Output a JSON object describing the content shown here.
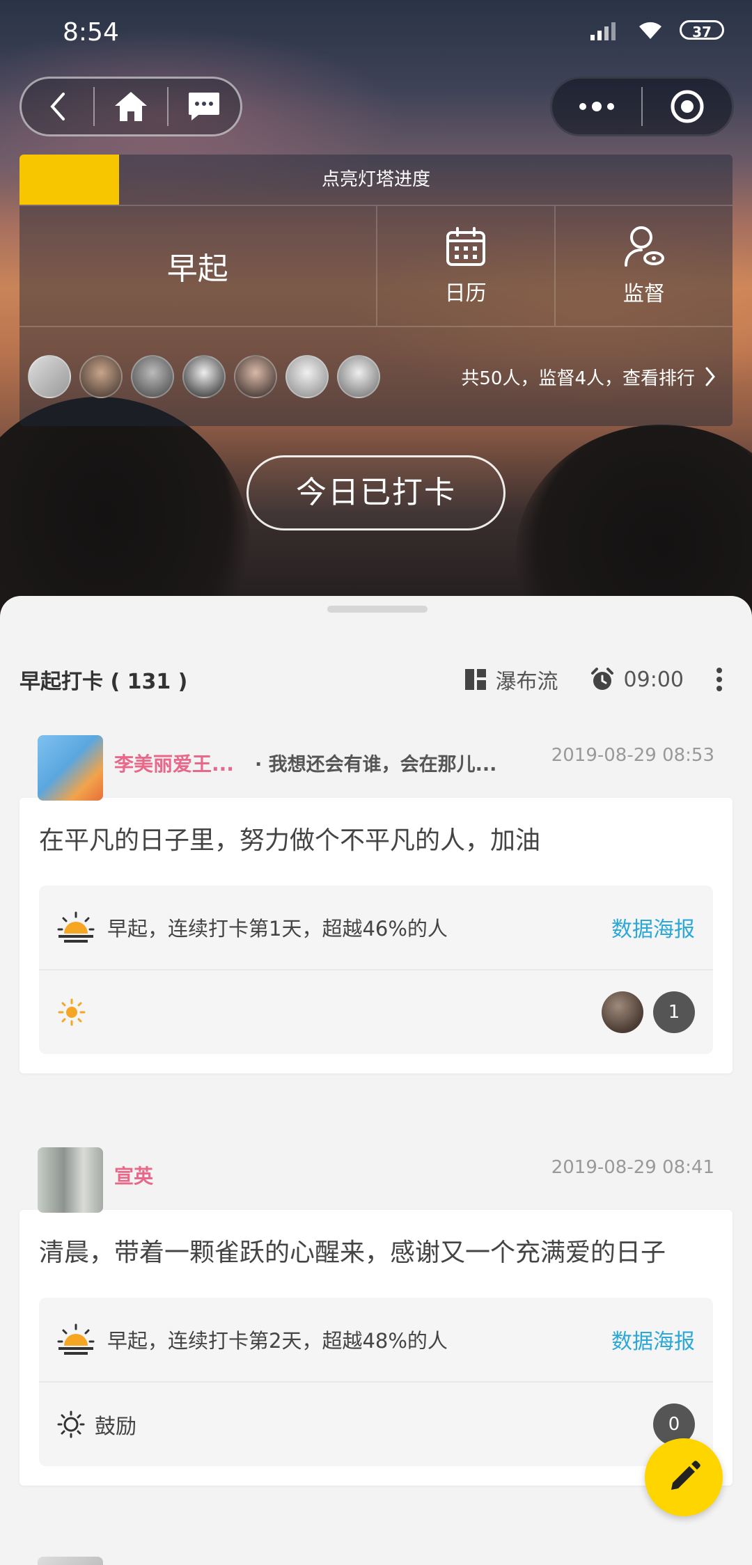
{
  "status": {
    "time": "8:54",
    "battery": "37"
  },
  "hero": {
    "progress_label": "点亮灯塔进度",
    "progress_fraction": 0.14,
    "main_action": "早起",
    "calendar_label": "日历",
    "supervise_label": "监督",
    "members_summary": "共50人，监督4人，查看排行",
    "checkin_button": "今日已打卡"
  },
  "feed": {
    "title": "早起打卡 ( 131 )",
    "layout_label": "瀑布流",
    "alarm_time": "09:00"
  },
  "posts": [
    {
      "name": "李美丽爱王...",
      "sub": "· 我想还会有谁，会在那儿...",
      "time": "2019-08-29 08:53",
      "text": "在平凡的日子里，努力做个不平凡的人，加油",
      "stat": "早起，连续打卡第1天，超越46%的人",
      "poster_link": "数据海报",
      "react_count": "1"
    },
    {
      "name": "宣英",
      "time": "2019-08-29 08:41",
      "text": "清晨，带着一颗雀跃的心醒来，感谢又一个充满爱的日子",
      "stat": "早起，连续打卡第2天，超越48%的人",
      "poster_link": "数据海报",
      "encourage_label": "鼓励",
      "react_count": "0"
    }
  ],
  "colors": {
    "accent_yellow": "#f7c600",
    "link_blue": "#2ba8d6",
    "name_pink": "#e8688a",
    "fab": "#ffd500"
  }
}
